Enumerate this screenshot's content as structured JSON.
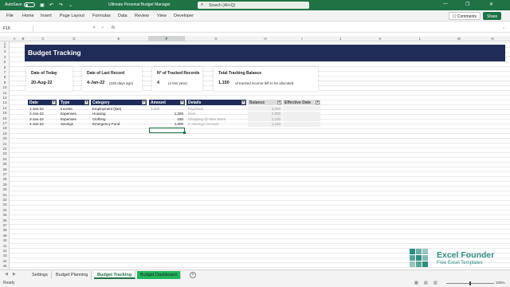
{
  "titlebar": {
    "autosave_label": "AutoSave",
    "toggle_state": "Off",
    "doc_title": "Ultimate Personal Budget Manager",
    "search_placeholder": "Search (Alt+Q)"
  },
  "menu": [
    "File",
    "Home",
    "Insert",
    "Page Layout",
    "Formulas",
    "Data",
    "Review",
    "View",
    "Developer"
  ],
  "actions": {
    "comments": "Comments",
    "share": "Share"
  },
  "formula_bar": {
    "name_box": "F16",
    "fx": "fx",
    "value": ""
  },
  "columns": [
    "A",
    "B",
    "C",
    "D",
    "E",
    "F",
    "G",
    "H",
    "I",
    "J",
    "K",
    "L",
    "M",
    "N"
  ],
  "selected_column": "F",
  "rows": [
    "1",
    "2",
    "3",
    "4",
    "5",
    "6",
    "7",
    "8",
    "9",
    "10",
    "11",
    "12",
    "13",
    "14",
    "15",
    "16",
    "17",
    "18",
    "19",
    "20",
    "21",
    "22",
    "23",
    "24",
    "25",
    "26",
    "27",
    "28",
    "29",
    "30",
    "31",
    "32",
    "33",
    "34",
    "35",
    "36",
    "37",
    "38",
    "39",
    "40",
    "41",
    "42",
    "43",
    "44",
    "45",
    "46"
  ],
  "banner_title": "Budget Tracking",
  "cards": [
    {
      "label": "Date of Today",
      "value": "20-Aug-22",
      "note": ""
    },
    {
      "label": "Date of Last Record",
      "value": "4-Jan-22",
      "note": "(228 days ago)"
    },
    {
      "label": "N° of Tracked Records",
      "value": "4",
      "note": "(4 this year)"
    },
    {
      "label": "Total Tracking Balance",
      "value": "1,150",
      "note": "of tracked income left to be allocated"
    }
  ],
  "table": {
    "headers": [
      "Date",
      "Type",
      "Category",
      "Amount",
      "Details",
      "Balance",
      "Effective Date"
    ],
    "rows": [
      [
        "1-Jan-22",
        "Income",
        "Employment (Net)",
        "3,000",
        "Paycheck",
        "3,000",
        ""
      ],
      [
        "2-Jan-22",
        "Expenses",
        "Housing",
        "1,200",
        "Rent",
        "2,300",
        ""
      ],
      [
        "3-Jan-22",
        "Expenses",
        "Clothing",
        "150",
        "Shopping @ Nike Store",
        "2,150",
        ""
      ],
      [
        "4-Jan-22",
        "Savings",
        "Emergency Fund",
        "1,000",
        "In Savings Account",
        "1,150",
        ""
      ]
    ]
  },
  "logo": {
    "brand": "Excel Founder",
    "tagline": "Free Excel Templates"
  },
  "sheet_tabs": [
    "Settings",
    "Budget Planning",
    "Budget Tracking",
    "Budget Dashboard"
  ],
  "active_tab": "Budget Tracking",
  "status": {
    "ready": "Ready",
    "zoom": "100%"
  },
  "colors": {
    "excel_green": "#1f7244",
    "banner_navy": "#1f2c57",
    "logo_teal": "#2f8d80",
    "dashboard_tab": "#21b45c"
  }
}
